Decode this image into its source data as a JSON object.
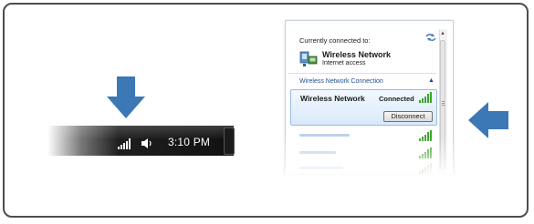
{
  "taskbar": {
    "time": "3:10 PM",
    "icons": [
      "network-signal-icon",
      "volume-icon"
    ]
  },
  "popup": {
    "current_label": "Currently connected to:",
    "current_network": {
      "name": "Wireless Network",
      "status": "Internet access"
    },
    "section_header": "Wireless Network Connection",
    "selected_network": {
      "name": "Wireless Network",
      "status": "Connected",
      "button_label": "Disconnect"
    },
    "other_networks_count_visible": 3
  },
  "colors": {
    "arrow": "#3b78b5",
    "taskbar": "#111111",
    "selection": "#d9e9fa",
    "signal": "#3fa42b",
    "section_header": "#1d4f91"
  },
  "icons": [
    "arrow-down-icon",
    "arrow-left-icon",
    "refresh-icon",
    "network-icon",
    "signal-strength-icon",
    "chevron-up-icon"
  ]
}
